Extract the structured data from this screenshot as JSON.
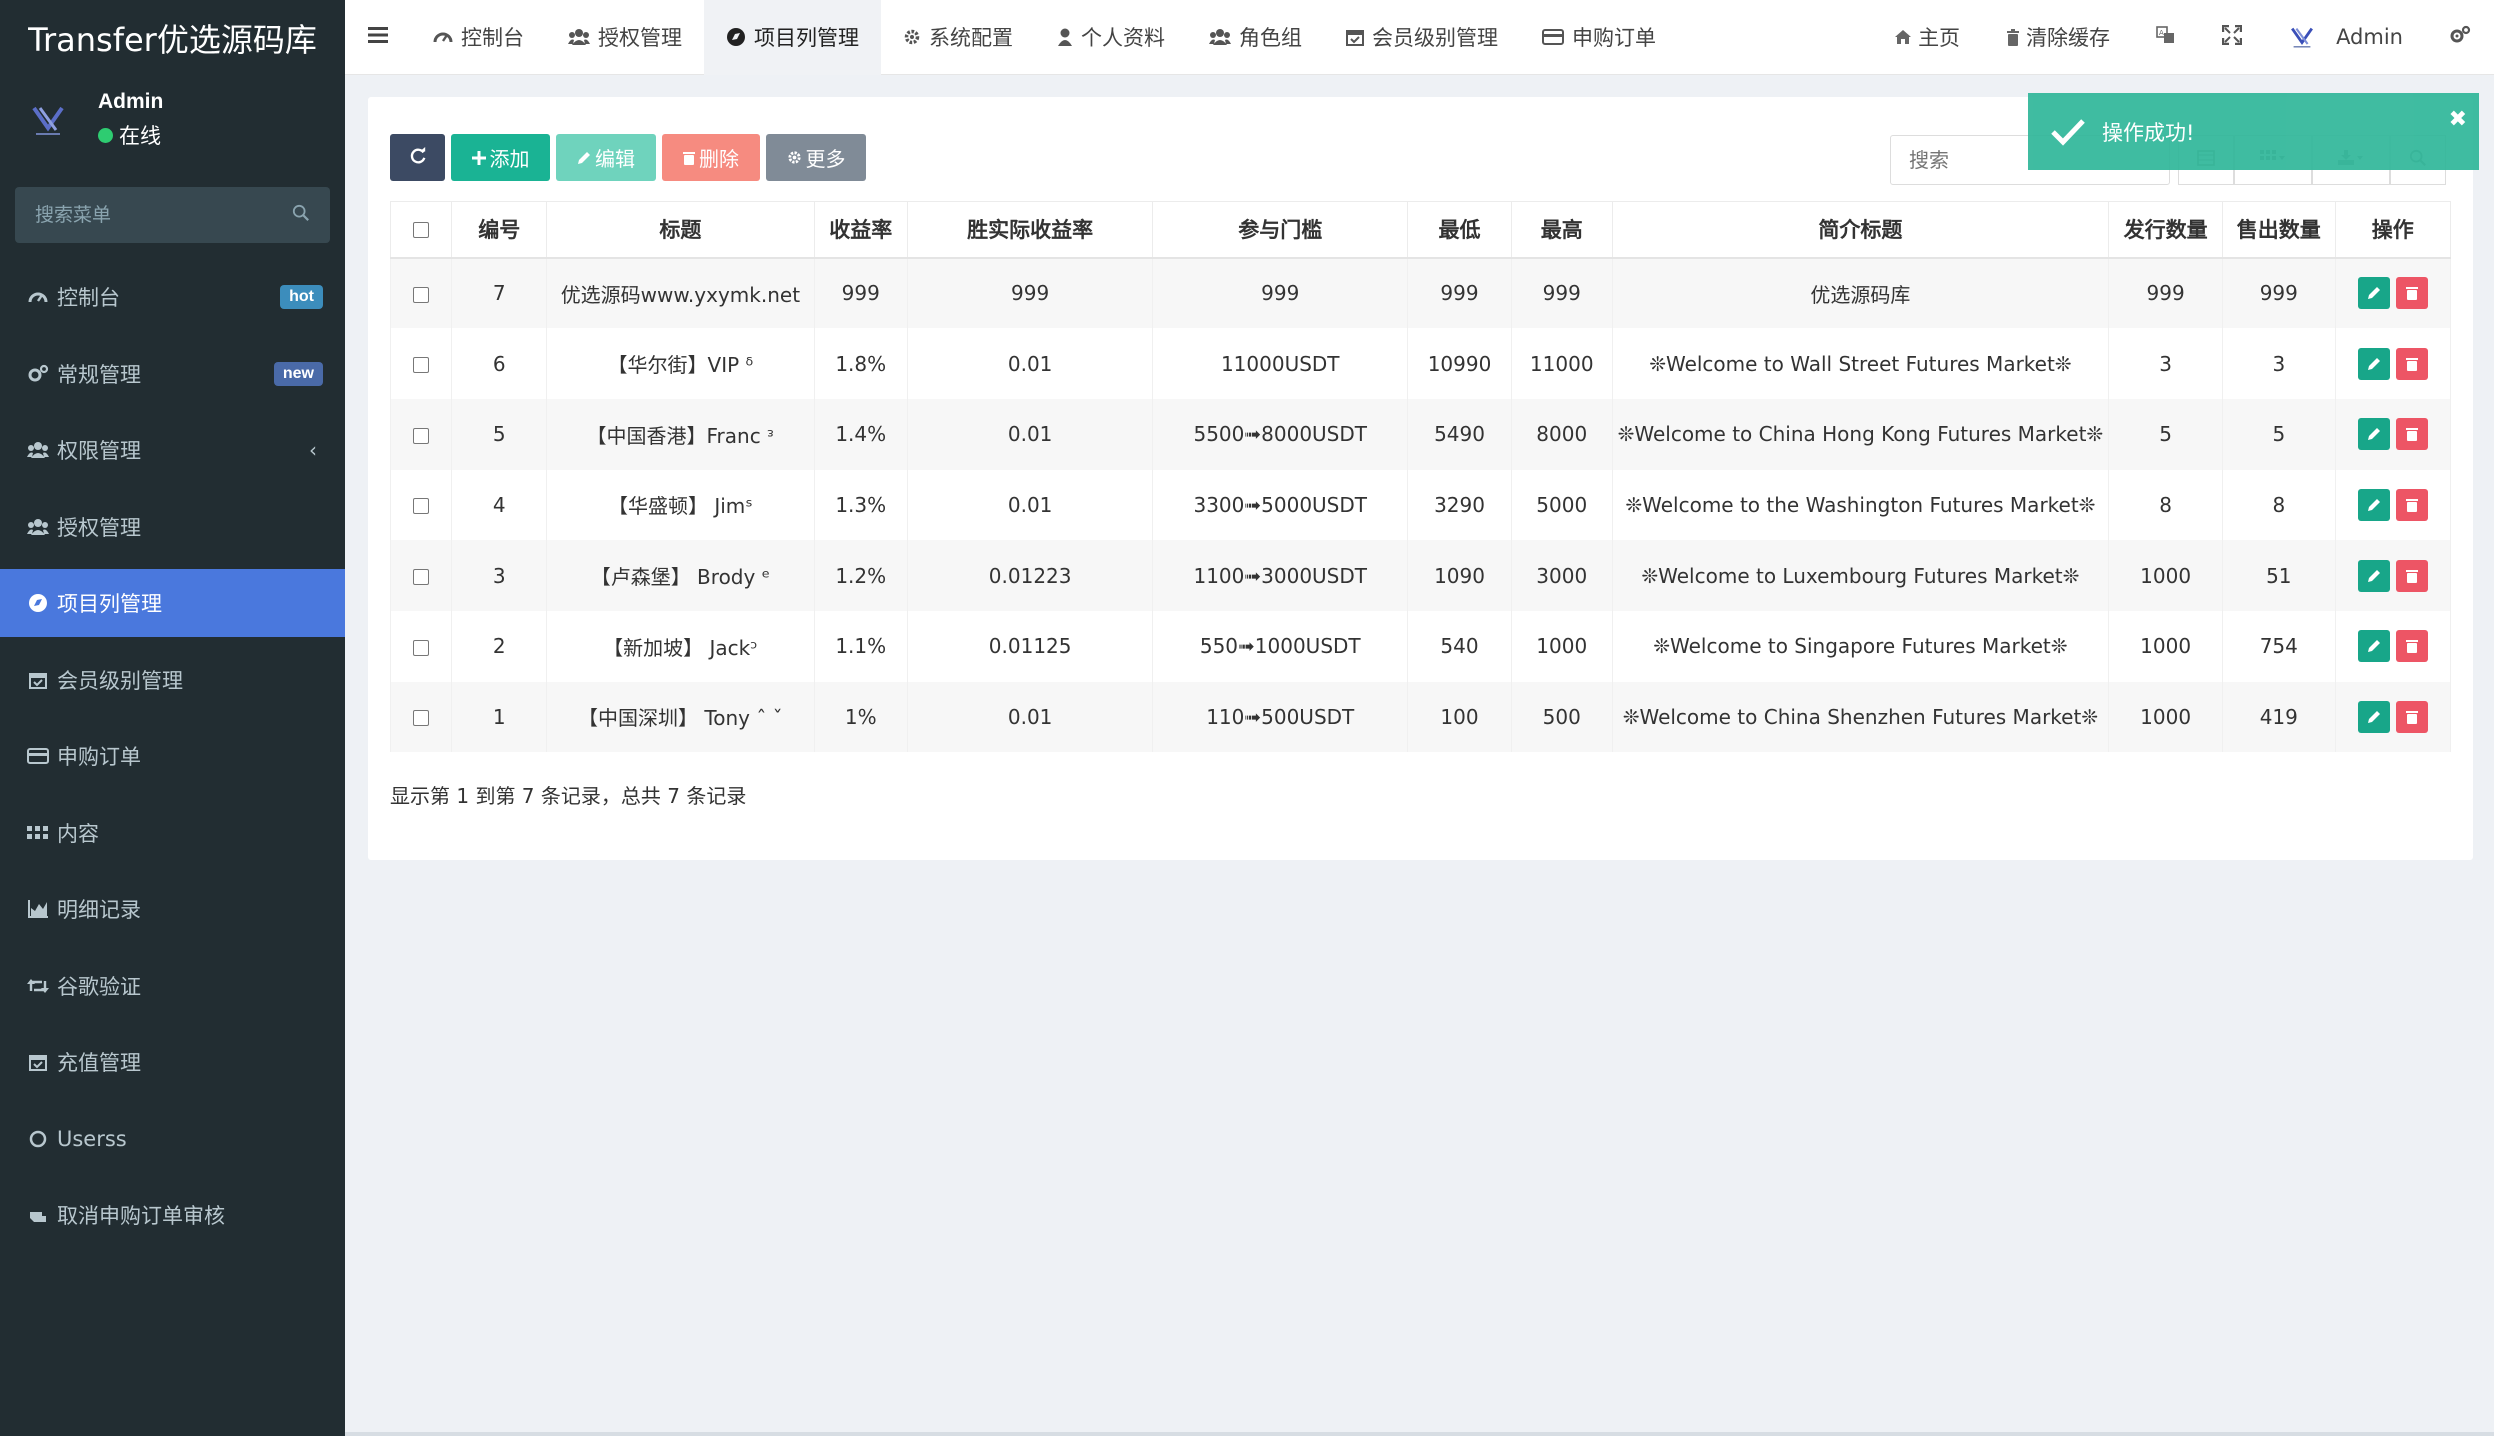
{
  "brand": {
    "title": "Transfer优选源码库"
  },
  "user": {
    "name": "Admin",
    "status": "在线"
  },
  "sidebar": {
    "search_placeholder": "搜索菜单",
    "items": [
      {
        "label": "控制台",
        "icon": "dashboard-icon",
        "badge": "hot",
        "badge_color": "#3c8dbc"
      },
      {
        "label": "常规管理",
        "icon": "cogs-icon",
        "badge": "new",
        "badge_color": "#4a6aa8"
      },
      {
        "label": "权限管理",
        "icon": "group-icon",
        "chevron": "‹"
      },
      {
        "label": "授权管理",
        "icon": "group-icon"
      },
      {
        "label": "项目列管理",
        "icon": "circle-icon",
        "active": true
      },
      {
        "label": "会员级别管理",
        "icon": "calendar-check-icon"
      },
      {
        "label": "申购订单",
        "icon": "credit-card-icon"
      },
      {
        "label": "内容",
        "icon": "grid-icon"
      },
      {
        "label": "明细记录",
        "icon": "area-chart-icon"
      },
      {
        "label": "谷歌验证",
        "icon": "retweet-icon"
      },
      {
        "label": "充值管理",
        "icon": "calendar-check-icon"
      },
      {
        "label": "Userss",
        "icon": "circle-outline-icon"
      },
      {
        "label": "取消申购订单审核",
        "icon": "hand-icon"
      }
    ]
  },
  "topnav": {
    "tabs": [
      {
        "label": "控制台",
        "icon": "dashboard-icon"
      },
      {
        "label": "授权管理",
        "icon": "group-icon"
      },
      {
        "label": "项目列管理",
        "icon": "circle-icon",
        "active": true
      },
      {
        "label": "系统配置",
        "icon": "gear-icon"
      },
      {
        "label": "个人资料",
        "icon": "user-icon"
      },
      {
        "label": "角色组",
        "icon": "group-icon"
      },
      {
        "label": "会员级别管理",
        "icon": "calendar-check-icon"
      },
      {
        "label": "申购订单",
        "icon": "credit-card-icon"
      }
    ],
    "home_label": "主页",
    "clear_cache_label": "清除缓存",
    "admin_label": "Admin"
  },
  "toolbar": {
    "add_label": "添加",
    "edit_label": "编辑",
    "delete_label": "删除",
    "more_label": "更多",
    "search_placeholder": "搜索"
  },
  "toast": {
    "message": "操作成功!"
  },
  "table": {
    "columns": [
      "编号",
      "标题",
      "收益率",
      "胜实际收益率",
      "参与门槛",
      "最低",
      "最高",
      "简介标题",
      "发行数量",
      "售出数量",
      "操作"
    ],
    "rows": [
      [
        "7",
        "优选源码www.yxymk.net",
        "999",
        "999",
        "999",
        "999",
        "999",
        "优选源码库",
        "999",
        "999"
      ],
      [
        "6",
        "【华尔街】VIP ᵟ",
        "1.8%",
        "0.01",
        "11000USDT",
        "10990",
        "11000",
        "❊Welcome to Wall Street Futures Market❊",
        "3",
        "3"
      ],
      [
        "5",
        "【中国香港】Franc ᵌ",
        "1.4%",
        "0.01",
        "5500➟8000USDT",
        "5490",
        "8000",
        "❊Welcome to China Hong Kong Futures Market❊",
        "5",
        "5"
      ],
      [
        "4",
        "【华盛顿】 Jimˢ",
        "1.3%",
        "0.01",
        "3300➟5000USDT",
        "3290",
        "5000",
        "❊Welcome to the Washington Futures Market❊",
        "8",
        "8"
      ],
      [
        "3",
        "【卢森堡】 Brody ᵉ",
        "1.2%",
        "0.01223",
        "1100➟3000USDT",
        "1090",
        "3000",
        "❊Welcome to Luxembourg Futures Market❊",
        "1000",
        "51"
      ],
      [
        "2",
        "【新加坡】 Jackᵓ",
        "1.1%",
        "0.01125",
        "550➟1000USDT",
        "540",
        "1000",
        "❊Welcome to Singapore Futures Market❊",
        "1000",
        "754"
      ],
      [
        "1",
        "【中国深圳】 Tony ˆ ˇ",
        "1%",
        "0.01",
        "110➟500USDT",
        "100",
        "500",
        "❊Welcome to China Shenzhen Futures Market❊",
        "1000",
        "419"
      ]
    ]
  },
  "pagination": {
    "summary": "显示第 1 到第 7 条记录，总共 7 条记录"
  },
  "colors": {
    "sidebar_bg": "#222d32",
    "active": "#4a78dd",
    "primary": "#1ab394",
    "danger": "#ed5565"
  }
}
